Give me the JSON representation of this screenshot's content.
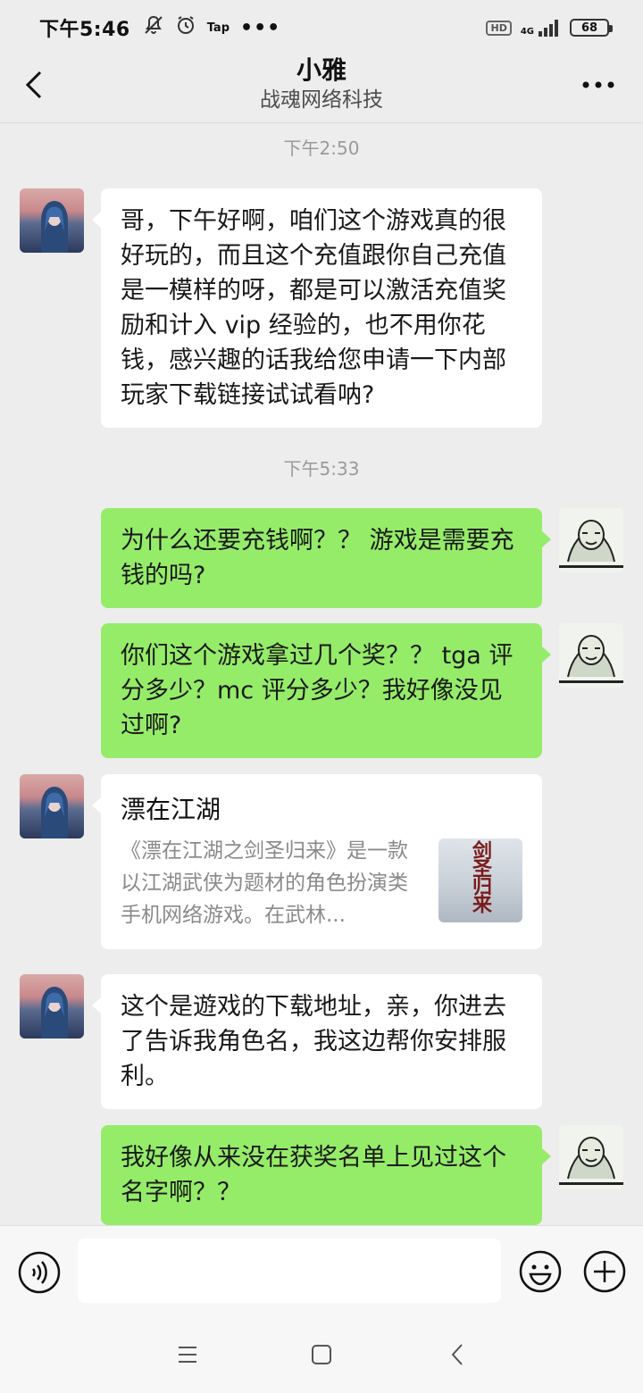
{
  "status": {
    "time": "下午5:46",
    "tap_label": "Tap",
    "hd": "HD",
    "network": "4G",
    "battery": "68"
  },
  "header": {
    "contact_name": "小雅",
    "company": "战魂网络科技"
  },
  "messages": [
    {
      "type": "time",
      "text": "下午2:50"
    },
    {
      "type": "text",
      "side": "left",
      "text": "哥，下午好啊，咱们这个游戏真的很好玩的，而且这个充值跟你自己充值是一模样的呀，都是可以激活充值奖励和计入 vip 经验的，也不用你花钱，感兴趣的话我给您申请一下内部玩家下载链接试试看呐?"
    },
    {
      "type": "time",
      "text": "下午5:33"
    },
    {
      "type": "text",
      "side": "right",
      "text": "为什么还要充钱啊？？ 游戏是需要充钱的吗?"
    },
    {
      "type": "text",
      "side": "right",
      "text": "你们这个游戏拿过几个奖？？ tga 评分多少？mc 评分多少？我好像没见过啊?"
    },
    {
      "type": "card",
      "side": "left",
      "title": "漂在江湖",
      "desc": "《漂在江湖之剑圣归来》是一款以江湖武侠为题材的角色扮演类手机网络游戏。在武林...",
      "thumb_text": "剑圣归来"
    },
    {
      "type": "text",
      "side": "left",
      "text": "这个是遊戏的下载地址，亲，你进去了告诉我角色名，我这边帮你安排服利。"
    },
    {
      "type": "text",
      "side": "right",
      "text": "我好像从来没在获奖名单上见过这个名字啊？？"
    }
  ],
  "input": {
    "placeholder": ""
  },
  "colors": {
    "bubble_mine": "#95ec69",
    "bubble_other": "#ffffff",
    "background": "#ededed"
  },
  "icons": [
    "back-icon",
    "more-icon",
    "voice-icon",
    "emoji-icon",
    "plus-icon",
    "menu-icon",
    "home-icon",
    "nav-back-icon"
  ]
}
